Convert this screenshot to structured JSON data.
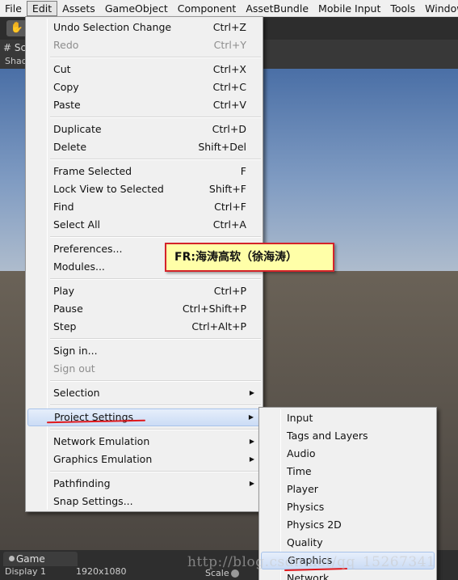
{
  "menubar": {
    "items": [
      "File",
      "Edit",
      "Assets",
      "GameObject",
      "Component",
      "AssetBundle",
      "Mobile Input",
      "Tools",
      "Window"
    ],
    "active_index": 1
  },
  "editor": {
    "hand_tool_icon": "hand-icon",
    "scene_tab_label": "# Sc",
    "scene_sub_label": "Shad",
    "game_tab_label": "Game",
    "display_label": "Display 1",
    "resolution_label": "1920x1080",
    "scale_label": "Scale"
  },
  "edit_menu": {
    "groups": [
      [
        {
          "label": "Undo Selection Change",
          "shortcut": "Ctrl+Z"
        },
        {
          "label": "Redo",
          "shortcut": "Ctrl+Y",
          "disabled": true
        }
      ],
      [
        {
          "label": "Cut",
          "shortcut": "Ctrl+X"
        },
        {
          "label": "Copy",
          "shortcut": "Ctrl+C"
        },
        {
          "label": "Paste",
          "shortcut": "Ctrl+V"
        }
      ],
      [
        {
          "label": "Duplicate",
          "shortcut": "Ctrl+D"
        },
        {
          "label": "Delete",
          "shortcut": "Shift+Del"
        }
      ],
      [
        {
          "label": "Frame Selected",
          "shortcut": "F"
        },
        {
          "label": "Lock View to Selected",
          "shortcut": "Shift+F"
        },
        {
          "label": "Find",
          "shortcut": "Ctrl+F"
        },
        {
          "label": "Select All",
          "shortcut": "Ctrl+A"
        }
      ],
      [
        {
          "label": "Preferences...",
          "shortcut": ""
        },
        {
          "label": "Modules...",
          "shortcut": ""
        }
      ],
      [
        {
          "label": "Play",
          "shortcut": "Ctrl+P"
        },
        {
          "label": "Pause",
          "shortcut": "Ctrl+Shift+P"
        },
        {
          "label": "Step",
          "shortcut": "Ctrl+Alt+P"
        }
      ],
      [
        {
          "label": "Sign in...",
          "shortcut": ""
        },
        {
          "label": "Sign out",
          "shortcut": "",
          "disabled": true
        }
      ],
      [
        {
          "label": "Selection",
          "shortcut": "",
          "submenu": true
        }
      ],
      [
        {
          "label": "Project Settings",
          "shortcut": "",
          "submenu": true,
          "highlighted": true
        }
      ],
      [
        {
          "label": "Network Emulation",
          "shortcut": "",
          "submenu": true
        },
        {
          "label": "Graphics Emulation",
          "shortcut": "",
          "submenu": true
        }
      ],
      [
        {
          "label": "Pathfinding",
          "shortcut": "",
          "submenu": true
        },
        {
          "label": "Snap Settings...",
          "shortcut": ""
        }
      ]
    ]
  },
  "project_settings_menu": {
    "items": [
      "Input",
      "Tags and Layers",
      "Audio",
      "Time",
      "Player",
      "Physics",
      "Physics 2D",
      "Quality",
      "Graphics",
      "Network"
    ],
    "highlighted_index": 8
  },
  "annotation": {
    "text": "FR:海涛高软（徐海涛）"
  },
  "watermark": {
    "text": "http://blog.csdn.net/qq_15267341"
  },
  "colors": {
    "menu_bg": "#f0f0f0",
    "highlight": "#cbdcf5",
    "underline_mark": "#e0191d",
    "annotation_bg": "#ffffa8",
    "annotation_border": "#d4232a"
  }
}
